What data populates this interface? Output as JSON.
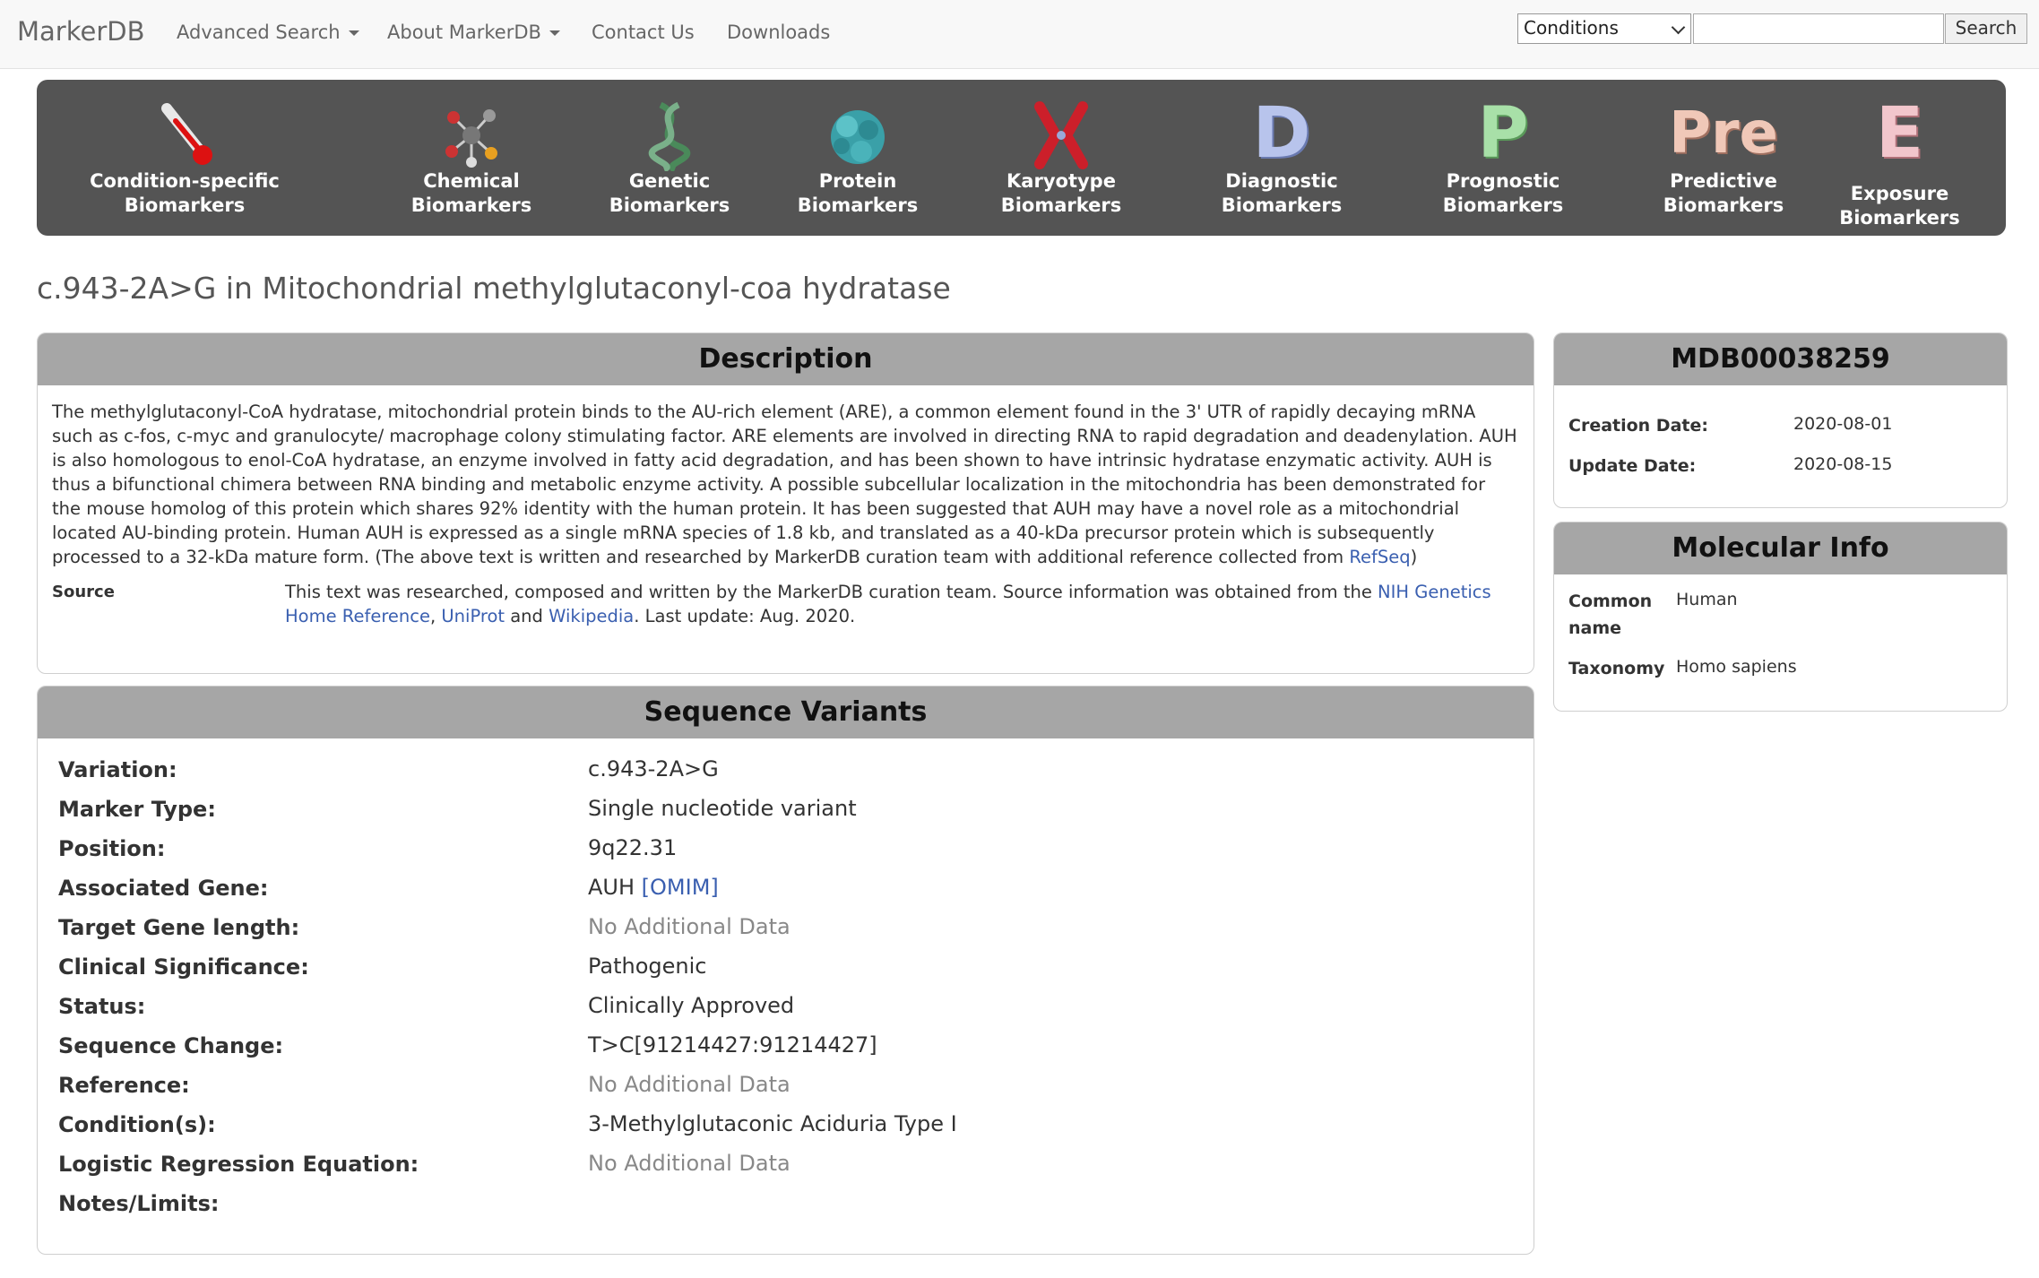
{
  "nav": {
    "brand": "MarkerDB",
    "items": [
      {
        "label": "Advanced Search",
        "dropdown": true
      },
      {
        "label": "About MarkerDB",
        "dropdown": true
      },
      {
        "label": "Contact Us",
        "dropdown": false
      },
      {
        "label": "Downloads",
        "dropdown": false
      }
    ],
    "search": {
      "selected": "Conditions",
      "placeholder": "",
      "button": "Search"
    }
  },
  "categories": [
    {
      "label": "Condition-specific\nBiomarkers",
      "icon": "thermometer-icon"
    },
    {
      "label": "Chemical\nBiomarkers",
      "icon": "molecule-icon"
    },
    {
      "label": "Genetic\nBiomarkers",
      "icon": "dna-icon"
    },
    {
      "label": "Protein\nBiomarkers",
      "icon": "protein-icon"
    },
    {
      "label": "Karyotype\nBiomarkers",
      "icon": "chromosome-icon"
    },
    {
      "label": "Diagnostic\nBiomarkers",
      "icon": "letter-d-icon",
      "letter": "D"
    },
    {
      "label": "Prognostic\nBiomarkers",
      "icon": "letter-p-icon",
      "letter": "P"
    },
    {
      "label": "Predictive\nBiomarkers",
      "icon": "letter-pre-icon",
      "letter": "Pre"
    },
    {
      "label": "Exposure Biomarkers",
      "icon": "letter-e-icon",
      "letter": "E"
    }
  ],
  "title": "c.943-2A>G in Mitochondrial methylglutaconyl-coa hydratase",
  "description": {
    "heading": "Description",
    "text": "The methylglutaconyl-CoA hydratase, mitochondrial protein binds to the AU-rich element (ARE), a common element found in the 3' UTR of rapidly decaying mRNA such as c-fos, c-myc and granulocyte/ macrophage colony stimulating factor. ARE elements are involved in directing RNA to rapid degradation and deadenylation. AUH is also homologous to enol-CoA hydratase, an enzyme involved in fatty acid degradation, and has been shown to have intrinsic hydratase enzymatic activity. AUH is thus a bifunctional chimera between RNA binding and metabolic enzyme activity. A possible subcellular localization in the mitochondria has been demonstrated for the mouse homolog of this protein which shares 92% identity with the human protein. It has been suggested that AUH may have a novel role as a mitochondrial located AU-binding protein. Human AUH is expressed as a single mRNA species of 1.8 kb, and translated as a 40-kDa precursor protein which is subsequently processed to a 32-kDa mature form. (The above text is written and researched by MarkerDB curation team with additional reference collected from ",
    "refseq_link": "RefSeq",
    "text_end": ")",
    "source_label": "Source",
    "source_text_1": "This text was researched, composed and written by the MarkerDB curation team. Source information was obtained from the ",
    "source_link_1": "NIH Genetics Home Reference",
    "source_sep_1": ", ",
    "source_link_2": "UniProt",
    "source_sep_2": " and ",
    "source_link_3": "Wikipedia",
    "source_text_2": ". Last update: Aug. 2020."
  },
  "record": {
    "id": "MDB00038259",
    "creation_label": "Creation Date:",
    "creation_value": "2020-08-01",
    "update_label": "Update Date:",
    "update_value": "2020-08-15"
  },
  "molecular": {
    "heading": "Molecular Info",
    "common_label_1": "Common",
    "common_label_2": "name",
    "common_value": "Human",
    "taxonomy_label": "Taxonomy",
    "taxonomy_value": "Homo sapiens"
  },
  "variants": {
    "heading": "Sequence Variants",
    "rows": [
      {
        "label": "Variation:",
        "value": "c.943-2A>G"
      },
      {
        "label": "Marker Type:",
        "value": "Single nucleotide variant"
      },
      {
        "label": "Position:",
        "value": "9q22.31"
      },
      {
        "label": "Associated Gene:",
        "value": "AUH",
        "link": "[OMIM]"
      },
      {
        "label": "Target Gene length:",
        "value": "No Additional Data",
        "muted": true
      },
      {
        "label": "Clinical Significance:",
        "value": "Pathogenic"
      },
      {
        "label": "Status:",
        "value": "Clinically Approved"
      },
      {
        "label": "Sequence Change:",
        "value": "T>C[91214427:91214427]"
      },
      {
        "label": "Reference:",
        "value": "No Additional Data",
        "muted": true
      },
      {
        "label": "Condition(s):",
        "value": "3-Methylglutaconic Aciduria Type I",
        "is_link": true
      },
      {
        "label": "Logistic Regression Equation:",
        "value": "No Additional Data",
        "muted": true
      },
      {
        "label": "Notes/Limits:",
        "value": ""
      }
    ]
  }
}
